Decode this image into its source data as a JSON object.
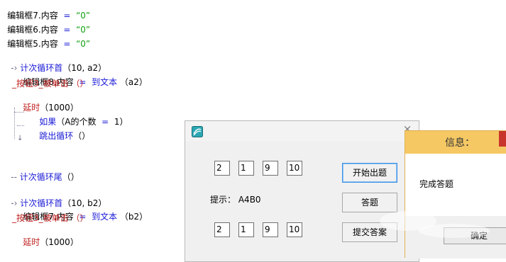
{
  "code": {
    "line1": {
      "obj": "编辑框7.内容",
      "op": "=",
      "val": "“0”"
    },
    "line2": {
      "obj": "编辑框6.内容",
      "op": "=",
      "val": "“0”"
    },
    "line3": {
      "obj": "编辑框5.内容",
      "op": "=",
      "val": "“0”"
    },
    "loop1_head": {
      "cmd": "计次循环首",
      "args": "（10, a2）"
    },
    "loop1_l1": {
      "obj": "编辑框8.内容",
      "op": "=",
      "fn": "到文本",
      "args": "（a2）"
    },
    "loop1_l2": {
      "text": "_按钮3_被单击 （）"
    },
    "loop1_l3": {
      "cmd": "延时",
      "args": "（1000）"
    },
    "if_line": {
      "cmd": "如果",
      "args": "（A的个数",
      "op": "=",
      "num": "1",
      "close": "）"
    },
    "break_line": {
      "cmd": "跳出循环",
      "args": "（）"
    },
    "loop1_tail": {
      "cmd": "计次循环尾",
      "args": "（）"
    },
    "loop2_head": {
      "cmd": "计次循环首",
      "args": "（10, b2）"
    },
    "loop2_l1": {
      "obj": "编辑框7.内容",
      "op": "=",
      "fn": "到文本",
      "args": "（b2）"
    },
    "loop2_l2": {
      "text": "_按钮3_被单击 （）"
    },
    "loop2_l3": {
      "cmd": "延时",
      "args": "（1000）"
    }
  },
  "app": {
    "row1": [
      "2",
      "1",
      "9",
      "10"
    ],
    "row2": [
      "2",
      "1",
      "9",
      "10"
    ],
    "hint_label": "提示：",
    "hint_value": "A4B0",
    "btn_start": "开始出题",
    "btn_answer": "答题",
    "btn_submit": "提交答案",
    "close_glyph": "×"
  },
  "msgbox": {
    "title": "信息：",
    "text": "完成答题",
    "ok": "确定",
    "close_glyph": "×"
  },
  "colors": {
    "keyword": "#1a1ad6",
    "string": "#12a012",
    "event": "#c02020",
    "msg_title_bg": "#f5c864",
    "msg_close_bg": "#c8342c"
  }
}
